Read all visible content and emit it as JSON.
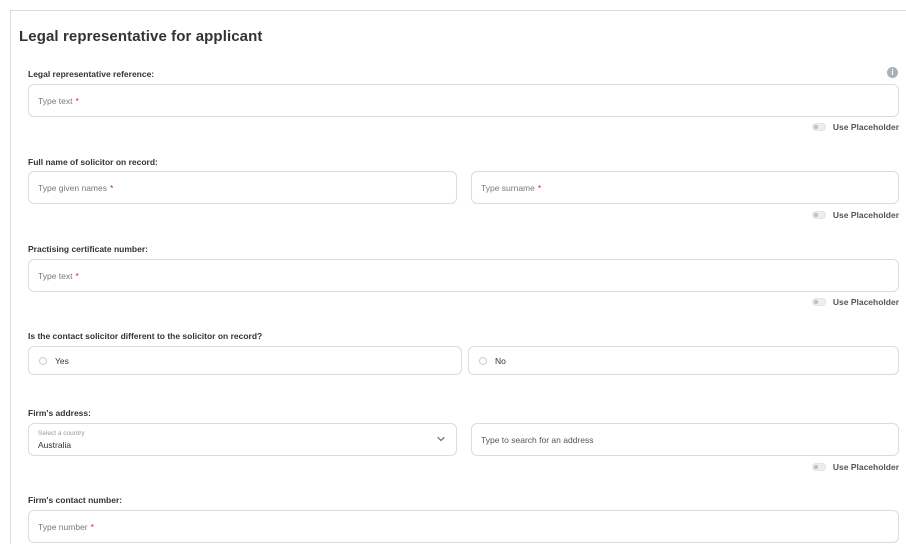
{
  "section": {
    "title": "Legal representative for applicant"
  },
  "reference": {
    "label": "Legal representative reference:",
    "placeholder": "Type text",
    "required_mark": "*",
    "toggle_label": "Use Placeholder"
  },
  "solicitor": {
    "label": "Full name of solicitor on record:",
    "given_placeholder": "Type given names",
    "surname_placeholder": "Type surname",
    "required_mark": "*",
    "toggle_label": "Use Placeholder"
  },
  "certificate": {
    "label": "Practising certificate number:",
    "placeholder": "Type text",
    "required_mark": "*",
    "toggle_label": "Use Placeholder"
  },
  "contact_question": {
    "label": "Is the contact solicitor different to the solicitor on record?",
    "options": [
      {
        "label": "Yes"
      },
      {
        "label": "No"
      }
    ]
  },
  "address": {
    "label": "Firm's address:",
    "country_hint": "Select a country",
    "country_value": "Australia",
    "search_placeholder": "Type to search for an address",
    "toggle_label": "Use Placeholder"
  },
  "contact_number": {
    "label": "Firm's contact number:",
    "placeholder": "Type number",
    "required_mark": "*"
  },
  "colors": {
    "required": "#d9202d",
    "border": "#dcdcdc",
    "info_icon": "#a9b0ba"
  },
  "icons": {
    "info": "info-icon",
    "dropdown": "chevron-down-icon"
  }
}
